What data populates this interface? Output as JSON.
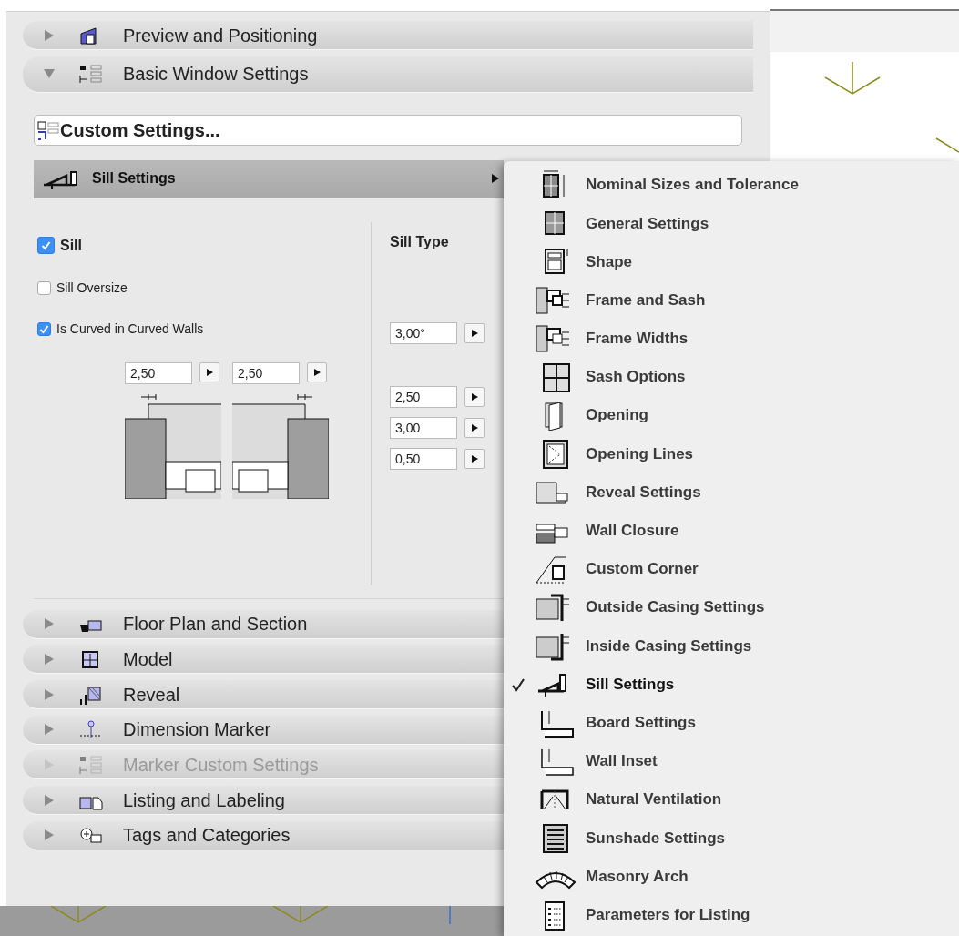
{
  "sections": [
    {
      "label": "Preview and Positioning",
      "expanded": false,
      "disabled": false
    },
    {
      "label": "Basic Window Settings",
      "expanded": true,
      "disabled": false
    },
    {
      "label": "Floor Plan and Section",
      "expanded": false,
      "disabled": false
    },
    {
      "label": "Model",
      "expanded": false,
      "disabled": false
    },
    {
      "label": "Reveal",
      "expanded": false,
      "disabled": false
    },
    {
      "label": "Dimension Marker",
      "expanded": false,
      "disabled": false
    },
    {
      "label": "Marker Custom Settings",
      "expanded": false,
      "disabled": true
    },
    {
      "label": "Listing and Labeling",
      "expanded": false,
      "disabled": false
    },
    {
      "label": "Tags and Categories",
      "expanded": false,
      "disabled": false
    }
  ],
  "custom_settings_button": {
    "label": "Custom Settings..."
  },
  "page_selector": {
    "label": "Sill Settings",
    "expanded": true
  },
  "sill_panel": {
    "checkboxes": [
      {
        "label": "Sill",
        "checked": true,
        "kind": "main"
      },
      {
        "label": "Sill Oversize",
        "checked": false,
        "kind": "sub"
      },
      {
        "label": "Is Curved in Curved Walls",
        "checked": true,
        "kind": "sub"
      }
    ],
    "width_inputs": [
      {
        "value": "2,50"
      },
      {
        "value": "2,50"
      }
    ],
    "sill_type": {
      "label": "Sill Type"
    },
    "type_inputs": [
      {
        "value": "3,00°"
      },
      {
        "value": "2,50"
      },
      {
        "value": "3,00"
      },
      {
        "value": "0,50"
      }
    ]
  },
  "menu": {
    "items": [
      {
        "label": "Nominal Sizes and Tolerance",
        "selected": false
      },
      {
        "label": "General Settings",
        "selected": false
      },
      {
        "label": "Shape",
        "selected": false
      },
      {
        "label": "Frame and Sash",
        "selected": false
      },
      {
        "label": "Frame Widths",
        "selected": false
      },
      {
        "label": "Sash Options",
        "selected": false
      },
      {
        "label": "Opening",
        "selected": false
      },
      {
        "label": "Opening Lines",
        "selected": false
      },
      {
        "label": "Reveal Settings",
        "selected": false
      },
      {
        "label": "Wall Closure",
        "selected": false
      },
      {
        "label": "Custom Corner",
        "selected": false
      },
      {
        "label": "Outside Casing Settings",
        "selected": false
      },
      {
        "label": "Inside Casing Settings",
        "selected": false
      },
      {
        "label": "Sill Settings",
        "selected": true
      },
      {
        "label": "Board Settings",
        "selected": false
      },
      {
        "label": "Wall Inset",
        "selected": false
      },
      {
        "label": "Natural Ventilation",
        "selected": false
      },
      {
        "label": "Sunshade Settings",
        "selected": false
      },
      {
        "label": "Masonry Arch",
        "selected": false
      },
      {
        "label": "Parameters for Listing",
        "selected": false
      }
    ]
  }
}
